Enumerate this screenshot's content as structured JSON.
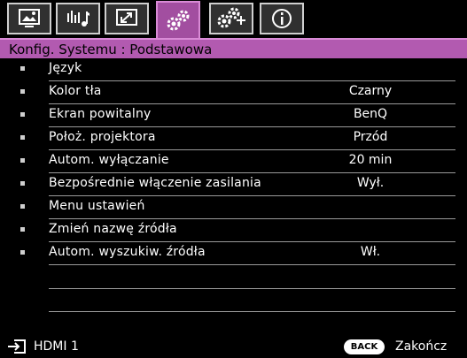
{
  "tabs": [
    {
      "icon": "picture-icon",
      "active": false
    },
    {
      "icon": "audio-settings-icon",
      "active": false
    },
    {
      "icon": "display-icon",
      "active": false
    },
    {
      "icon": "system-settings-basic-icon",
      "active": true
    },
    {
      "icon": "system-settings-advanced-icon",
      "active": false
    },
    {
      "icon": "information-icon",
      "active": false
    }
  ],
  "header": {
    "title": "Konfig. Systemu : Podstawowa"
  },
  "menu": {
    "items": [
      {
        "label": "Język",
        "value": ""
      },
      {
        "label": "Kolor tła",
        "value": "Czarny"
      },
      {
        "label": "Ekran powitalny",
        "value": "BenQ"
      },
      {
        "label": "Położ. projektora",
        "value": "Przód"
      },
      {
        "label": "Autom. wyłączanie",
        "value": "20 min"
      },
      {
        "label": "Bezpośrednie włączenie zasilania",
        "value": "Wył."
      },
      {
        "label": "Menu ustawień",
        "value": ""
      },
      {
        "label": "Zmień nazwę źródła",
        "value": ""
      },
      {
        "label": "Autom. wyszukiw. źródła",
        "value": "Wł."
      }
    ]
  },
  "footer": {
    "source_icon": "input-source-icon",
    "source_label": "HDMI 1",
    "back_label": "BACK",
    "exit_label": "Zakończ"
  },
  "colors": {
    "accent": "#b25ab0",
    "background": "#000000",
    "text": "#ffffff"
  }
}
